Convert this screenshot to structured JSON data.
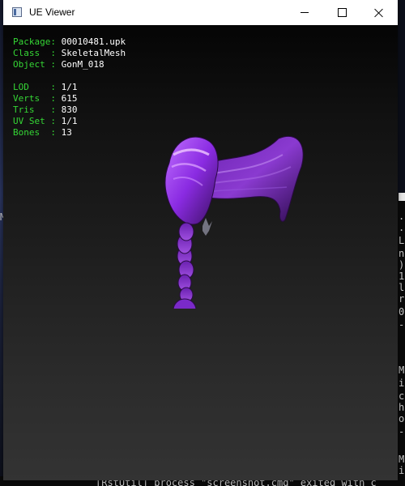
{
  "window": {
    "title": "UE Viewer"
  },
  "info": {
    "package": {
      "key": "Package",
      "sep": ": ",
      "value": "00010481.upk"
    },
    "class": {
      "key": "Class  ",
      "sep": ": ",
      "value": "SkeletalMesh"
    },
    "object": {
      "key": "Object ",
      "sep": ": ",
      "value": "GonM_018"
    },
    "lod": {
      "key": "LOD    ",
      "sep": ": ",
      "value": "1/1"
    },
    "verts": {
      "key": "Verts  ",
      "sep": ": ",
      "value": "615"
    },
    "tris": {
      "key": "Tris   ",
      "sep": ": ",
      "value": "830"
    },
    "uvset": {
      "key": "UV Set ",
      "sep": ": ",
      "value": "1/1"
    },
    "bones": {
      "key": "Bones  ",
      "sep": ": ",
      "value": "13"
    }
  },
  "background": {
    "left_edge_text": "M",
    "console_chars": [
      ".",
      ".",
      "L",
      "n",
      ")",
      "1",
      "l",
      "r",
      "0",
      "-",
      "M",
      "i",
      "c",
      "h",
      "o",
      "-",
      "M",
      "i"
    ],
    "bottom_console_text": "[RstUtil] process \"screenshot.cmd\" exited with c"
  },
  "colors": {
    "label_green": "#35d635",
    "value_white": "#ffffff",
    "mesh_purple": "#8a2be2"
  },
  "icons": {
    "app": "app-window-icon",
    "minimize": "minimize-icon",
    "maximize": "maximize-icon",
    "close": "close-icon"
  }
}
